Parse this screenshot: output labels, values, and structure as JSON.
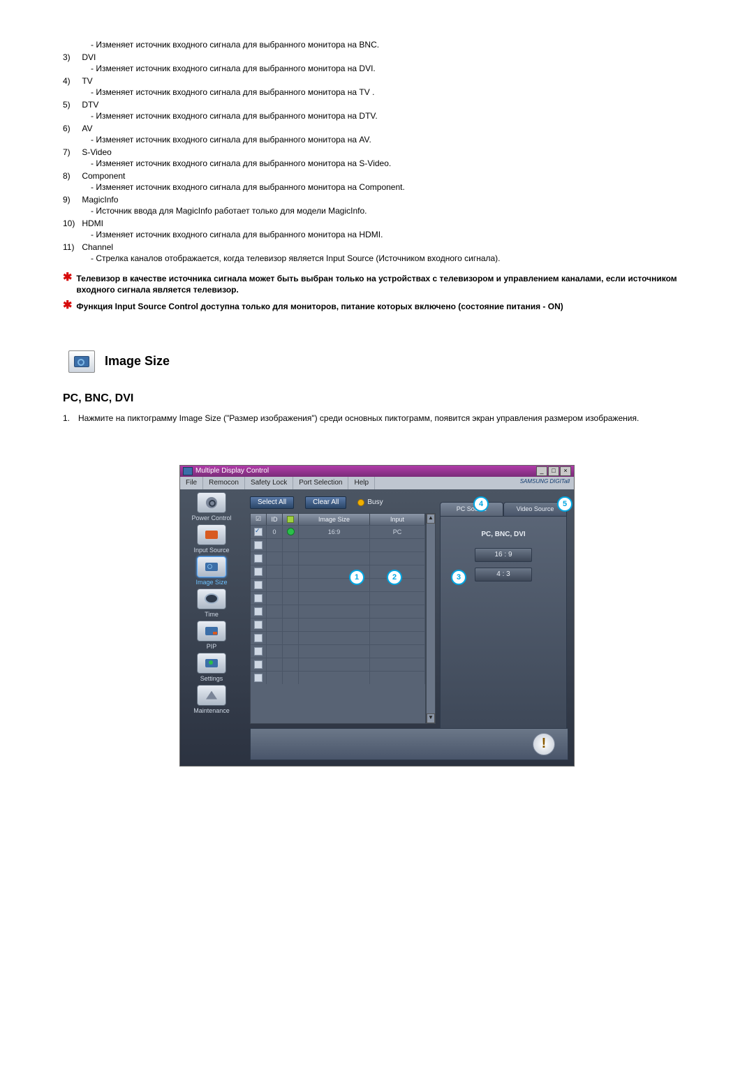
{
  "sources": [
    {
      "num": "",
      "label": "",
      "desc": "- Изменяет источник входного сигнала для выбранного монитора на BNC."
    },
    {
      "num": "3)",
      "label": "DVI",
      "desc": "- Изменяет источник входного сигнала для выбранного монитора на DVI."
    },
    {
      "num": "4)",
      "label": "TV",
      "desc": "- Изменяет источник входного сигнала для выбранного монитора на TV ."
    },
    {
      "num": "5)",
      "label": "DTV",
      "desc": "- Изменяет источник входного сигнала для выбранного монитора на DTV."
    },
    {
      "num": "6)",
      "label": "AV",
      "desc": "- Изменяет источник входного сигнала для выбранного монитора на AV."
    },
    {
      "num": "7)",
      "label": "S-Video",
      "desc": "- Изменяет источник входного сигнала для выбранного монитора на S-Video."
    },
    {
      "num": "8)",
      "label": "Component",
      "desc": "- Изменяет источник входного сигнала для выбранного монитора на Component."
    },
    {
      "num": "9)",
      "label": "MagicInfo",
      "desc": "- Источник ввода для MagicInfo работает только для модели MagicInfo."
    },
    {
      "num": "10)",
      "label": "HDMI",
      "desc": "- Изменяет источник входного сигнала для выбранного монитора на HDMI."
    },
    {
      "num": "11)",
      "label": "Channel",
      "desc": "- Стрелка каналов отображается, когда телевизор является Input Source (Источником входного сигнала)."
    }
  ],
  "notes": [
    "Телевизор в качестве источника сигнала может быть выбран только на устройствах с телевизором и управлением каналами, если источником входного сигнала является телевизор.",
    "Функция Input Source Control доступна только для мониторов, питание которых включено (состояние питания - ON)"
  ],
  "section_title": "Image Size",
  "sub_title": "PC, BNC, DVI",
  "para_num": "1.",
  "para_text": "Нажмите на пиктограмму Image Size (\"Размер изображения\") среди основных пиктограмм, появится экран управления размером изображения.",
  "win": {
    "title": "Multiple Display Control",
    "menu": [
      "File",
      "Remocon",
      "Safety Lock",
      "Port Selection",
      "Help"
    ],
    "brand": "SAMSUNG DIGITall",
    "btn_select": "Select All",
    "btn_clear": "Clear All",
    "busy": "Busy",
    "sidebar": [
      {
        "label": "Power Control"
      },
      {
        "label": "Input Source"
      },
      {
        "label": "Image Size"
      },
      {
        "label": "Time"
      },
      {
        "label": "PIP"
      },
      {
        "label": "Settings"
      },
      {
        "label": "Maintenance"
      }
    ],
    "cols": {
      "chk": "☑",
      "id": "ID",
      "dot": "",
      "img": "Image Size",
      "inp": "Input"
    },
    "row0": {
      "id": "0",
      "img": "16:9",
      "inp": "PC"
    },
    "tabs": {
      "pc": "PC Source",
      "vid": "Video Source"
    },
    "panel_hdr": "PC, BNC, DVI",
    "opt1": "16 : 9",
    "opt2": "4 : 3",
    "callouts": {
      "c1": "1",
      "c2": "2",
      "c3": "3",
      "c4": "4",
      "c5": "5"
    },
    "winbtns": {
      "min": "_",
      "max": "□",
      "close": "×"
    },
    "scroll": {
      "up": "▲",
      "dn": "▼"
    },
    "warn": "!"
  }
}
